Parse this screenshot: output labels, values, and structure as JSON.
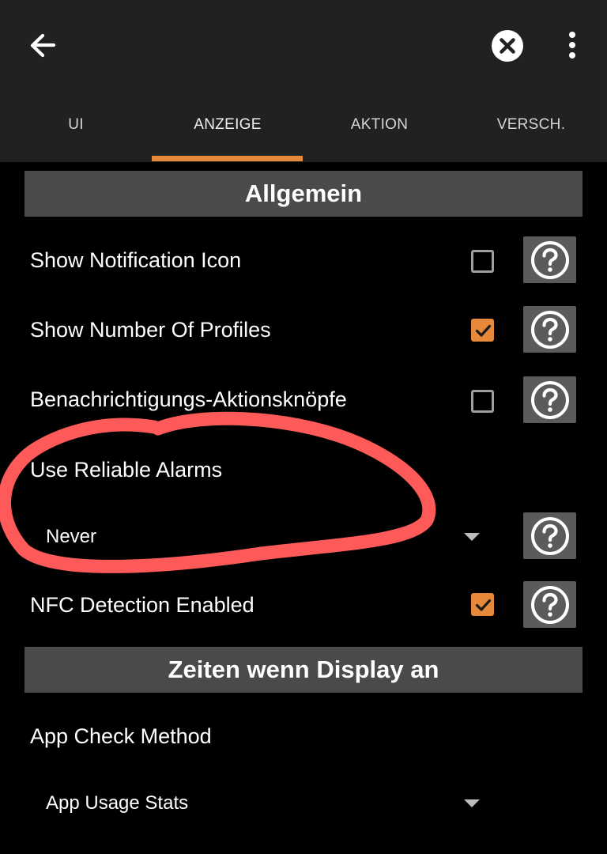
{
  "tabs": [
    {
      "label": "UI"
    },
    {
      "label": "ANZEIGE",
      "active": true
    },
    {
      "label": "AKTION"
    },
    {
      "label": "VERSCH."
    }
  ],
  "sections": {
    "general": {
      "title": "Allgemein"
    },
    "display_on": {
      "title": "Zeiten wenn Display an"
    }
  },
  "settings": {
    "show_notification_icon": {
      "label": "Show Notification Icon",
      "checked": false
    },
    "show_number_of_profiles": {
      "label": "Show Number Of Profiles",
      "checked": true
    },
    "notification_action_buttons": {
      "label": "Benachrichtigungs-Aktionsknöpfe",
      "checked": false
    },
    "use_reliable_alarms": {
      "label": "Use Reliable Alarms",
      "value": "Never"
    },
    "nfc_detection_enabled": {
      "label": "NFC Detection Enabled",
      "checked": true
    },
    "app_check_method": {
      "label": "App Check Method",
      "value": "App Usage Stats"
    }
  },
  "icons": {
    "back": "arrow-left-icon",
    "close": "close-circle-icon",
    "more": "more-vertical-icon",
    "help": "help-circle-icon",
    "dropdown": "caret-down-icon"
  },
  "colors": {
    "accent": "#e6893a",
    "appbar": "#212121",
    "section_header": "#4a4a4a",
    "help_button": "#5b5b5b",
    "annotation": "#ff5a5a"
  }
}
